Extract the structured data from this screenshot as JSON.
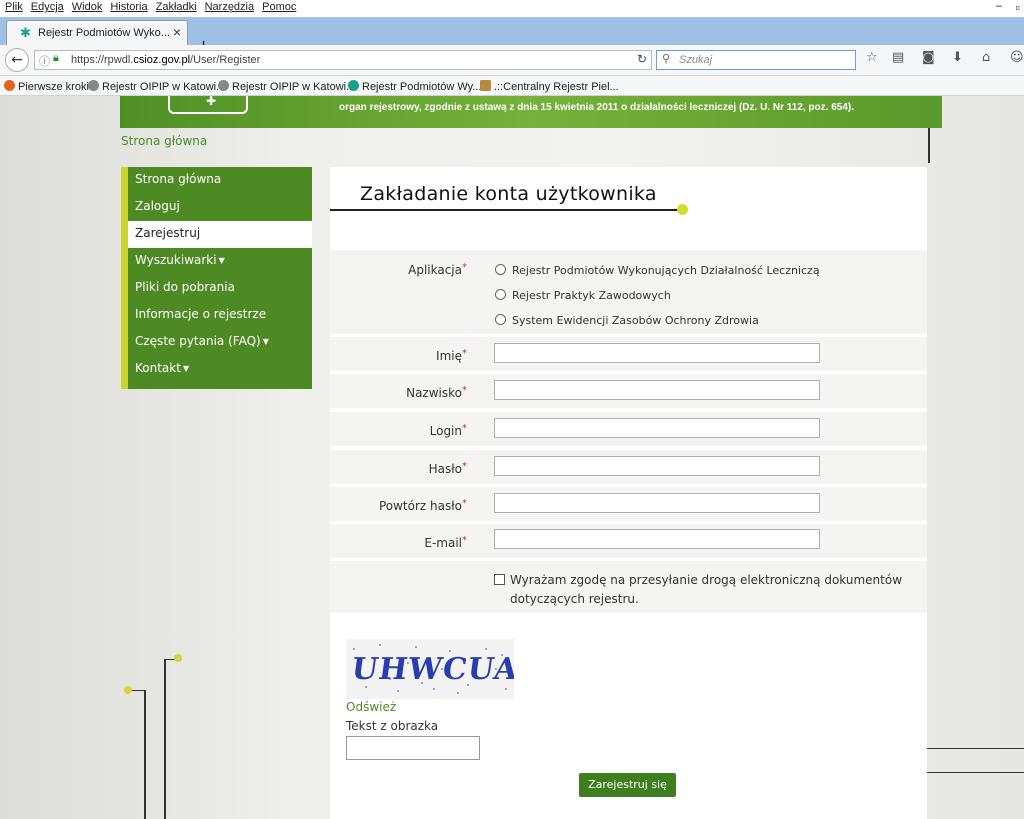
{
  "browser": {
    "menu": [
      "Plik",
      "Edycja",
      "Widok",
      "Historia",
      "Zakładki",
      "Narzędzia",
      "Pomoc"
    ],
    "tab_title": "Rejestr Podmiotów Wyko...",
    "url_prefix": "https://rpwdl.",
    "url_domain": "csioz.gov.pl",
    "url_path": "/User/Register",
    "search_placeholder": "Szukaj",
    "bookmarks": [
      "Pierwsze kroki",
      "Rejestr OIPIP w Katowi...",
      "Rejestr OIPIP w Katowi...",
      "Rejestr Podmiotów Wy...",
      ".::Centralny Rejestr Piel..."
    ]
  },
  "header": {
    "notice": "organ rejestrowy, zgodnie z ustawą z dnia 15 kwietnia 2011 o działalności leczniczej (Dz. U. Nr 112, poz. 654)."
  },
  "breadcrumb": "Strona główna",
  "sidebar": {
    "items": [
      {
        "label": "Strona główna",
        "active": false
      },
      {
        "label": "Zaloguj",
        "active": false
      },
      {
        "label": "Zarejestruj",
        "active": true
      },
      {
        "label": "Wyszukiwarki",
        "active": false,
        "dropdown": true
      },
      {
        "label": "Pliki do pobrania",
        "active": false
      },
      {
        "label": "Informacje o rejestrze",
        "active": false
      },
      {
        "label": "Częste pytania (FAQ)",
        "active": false,
        "dropdown": true
      },
      {
        "label": "Kontakt",
        "active": false,
        "dropdown": true
      }
    ]
  },
  "form": {
    "title": "Zakładanie konta użytkownika",
    "application_label": "Aplikacja",
    "application_options": [
      "Rejestr Podmiotów Wykonujących Działalność Leczniczą",
      "Rejestr Praktyk Zawodowych",
      "System Ewidencji Zasobów Ochrony Zdrowia"
    ],
    "fields": {
      "first_name": "Imię",
      "last_name": "Nazwisko",
      "login": "Login",
      "password": "Hasło",
      "repeat_password": "Powtórz hasło",
      "email": "E-mail"
    },
    "consent_line1": "Wyrażam zgodę na przesyłanie drogą elektroniczną dokumentów",
    "consent_line2": "dotyczących rejestru.",
    "captcha_text": "UHWCUA",
    "refresh_label": "Odśwież",
    "captcha_label": "Tekst z obrazka",
    "submit_label": "Zarejestruj się"
  },
  "colors": {
    "brand_green": "#4e8a23",
    "accent_yellow": "#c8d42f",
    "required_red": "#c0392b"
  }
}
